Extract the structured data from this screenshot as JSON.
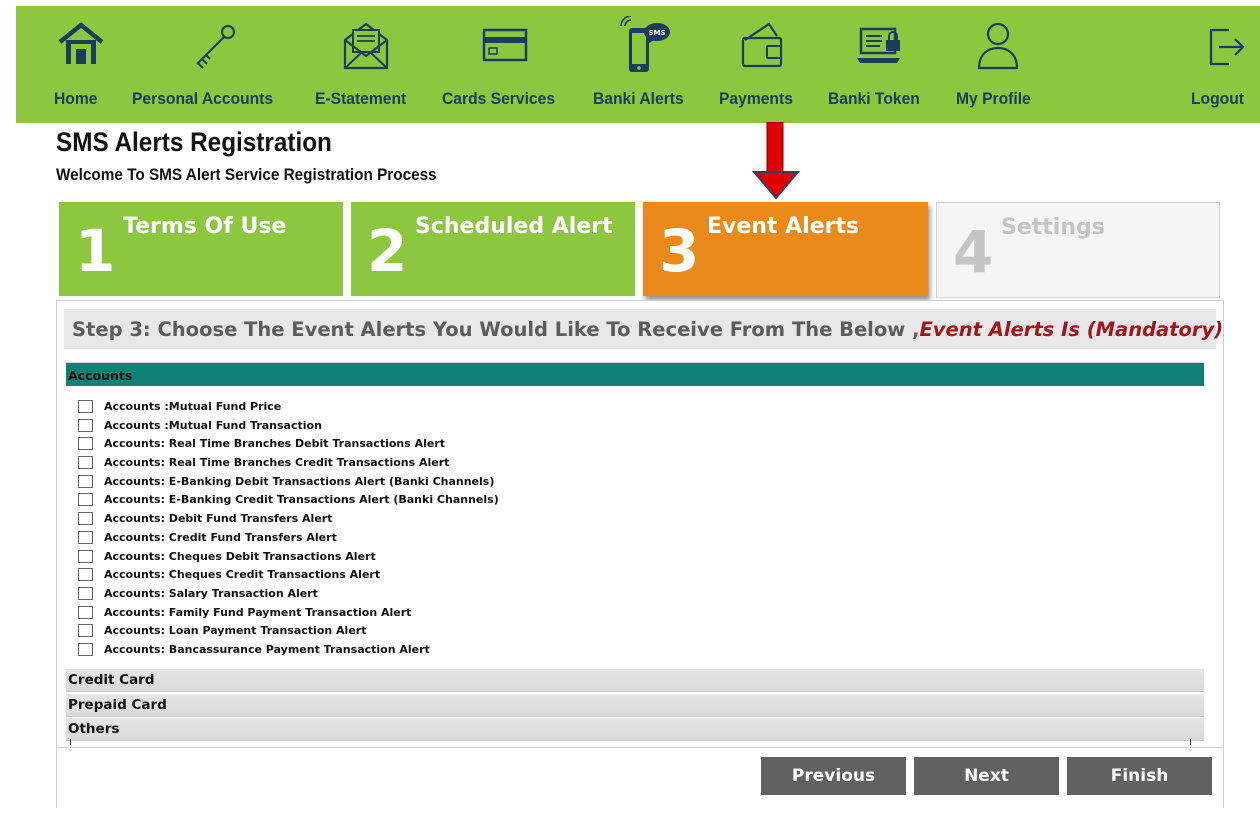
{
  "nav": {
    "home": "Home",
    "personal_accounts": "Personal Accounts",
    "e_statement": "E-Statement",
    "cards_services": "Cards Services",
    "banki_alerts": "Banki Alerts",
    "payments": "Payments",
    "banki_token": "Banki Token",
    "my_profile": "My Profile",
    "logout": "Logout",
    "sms_badge": "SMS"
  },
  "page": {
    "title": "SMS Alerts Registration",
    "subtitle": "Welcome To SMS Alert Service Registration Process"
  },
  "steps": [
    {
      "num": "1",
      "label": "Terms Of Use",
      "state": "done"
    },
    {
      "num": "2",
      "label": "Scheduled Alert",
      "state": "done"
    },
    {
      "num": "3",
      "label": "Event Alerts",
      "state": "active"
    },
    {
      "num": "4",
      "label": "Settings",
      "state": "disabled"
    }
  ],
  "step_header": {
    "text": "Step 3: Choose The Event Alerts You Would Like To Receive From The Below ,",
    "mandatory": "Event Alerts Is (Mandatory)"
  },
  "accounts": {
    "title": "Accounts",
    "items": [
      "Accounts :Mutual Fund Price",
      "Accounts :Mutual Fund Transaction",
      "Accounts: Real Time Branches Debit Transactions Alert",
      "Accounts: Real Time Branches Credit Transactions Alert",
      "Accounts: E-Banking Debit Transactions Alert (Banki Channels)",
      "Accounts: E-Banking Credit Transactions Alert (Banki Channels)",
      "Accounts: Debit Fund Transfers Alert",
      "Accounts: Credit Fund Transfers Alert",
      "Accounts: Cheques Debit Transactions Alert",
      "Accounts: Cheques Credit Transactions Alert",
      "Accounts: Salary Transaction Alert",
      "Accounts: Family Fund Payment Transaction Alert",
      "Accounts: Loan Payment Transaction Alert",
      "Accounts: Bancassurance Payment Transaction Alert"
    ]
  },
  "sections": {
    "credit_card": "Credit Card",
    "prepaid_card": "Prepaid Card",
    "others": "Others"
  },
  "buttons": {
    "previous": "Previous",
    "next": "Next",
    "finish": "Finish"
  },
  "colors": {
    "nav_green": "#8dc63f",
    "active_orange": "#e98a1b",
    "accounts_teal": "#0e8074",
    "mandatory_red": "#a3151a",
    "button_gray": "#616161",
    "arrow_red": "#e00000"
  }
}
